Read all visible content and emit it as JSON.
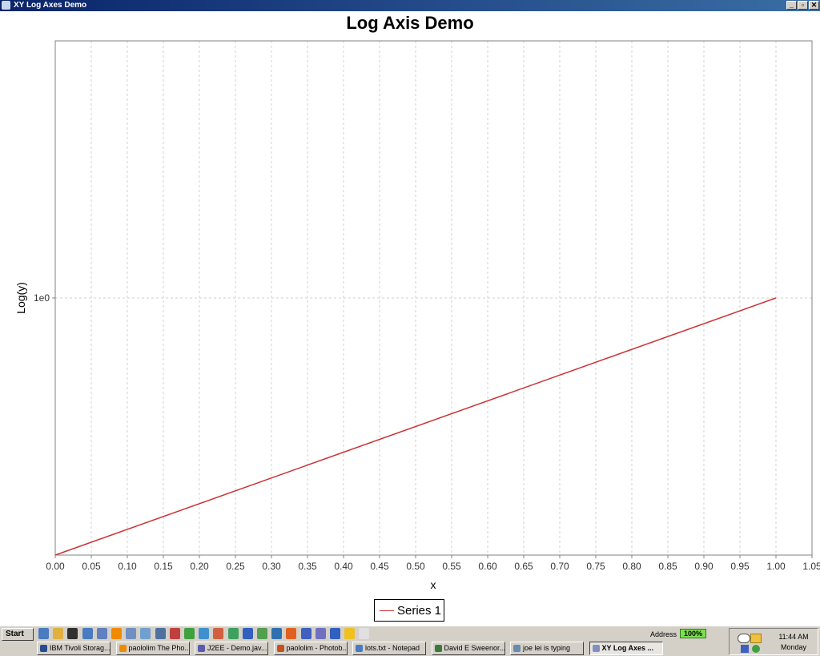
{
  "window": {
    "title": "XY Log Axes Demo",
    "controls": [
      "_",
      "▫",
      "✕"
    ]
  },
  "chart_data": {
    "type": "line",
    "title": "Log Axis Demo",
    "xlabel": "x",
    "ylabel": "Log(y)",
    "x_scale": "linear",
    "y_scale": "log",
    "xlim": [
      0,
      1.05
    ],
    "ylim": [
      0.1,
      10
    ],
    "x_ticks": [
      "0.00",
      "0.05",
      "0.10",
      "0.15",
      "0.20",
      "0.25",
      "0.30",
      "0.35",
      "0.40",
      "0.45",
      "0.50",
      "0.55",
      "0.60",
      "0.65",
      "0.70",
      "0.75",
      "0.80",
      "0.85",
      "0.90",
      "0.95",
      "1.00",
      "1.05"
    ],
    "y_ticks": [
      "1e0"
    ],
    "grid": true,
    "legend_position": "bottom",
    "series": [
      {
        "name": "Series 1",
        "color": "#cc3333",
        "x": [
          0.0,
          1.0
        ],
        "y": [
          0.1,
          1.0
        ]
      }
    ]
  },
  "legend": {
    "label": "Series 1"
  },
  "taskbar": {
    "start_label": "Start",
    "tasks": [
      {
        "label": "IBM Tivoli Storag...",
        "color": "#2a4b8d"
      },
      {
        "label": "paololim The Pho...",
        "color": "#f08a00"
      },
      {
        "label": "J2EE - Demo.jav...",
        "color": "#5a5ab0"
      },
      {
        "label": "paololim - Photob...",
        "color": "#c85020"
      },
      {
        "label": "lots.txt - Notepad",
        "color": "#4a7ac0"
      },
      {
        "label": "David E Sweenor...",
        "color": "#3a7a3a"
      },
      {
        "label": "joe lei is typing",
        "color": "#6a8ab0"
      },
      {
        "label": "XY Log Axes ...",
        "color": "#8090c0",
        "active": true
      }
    ],
    "address_label": "Address",
    "zoom": "100%",
    "clock_time": "11:44 AM",
    "clock_day": "Monday"
  }
}
